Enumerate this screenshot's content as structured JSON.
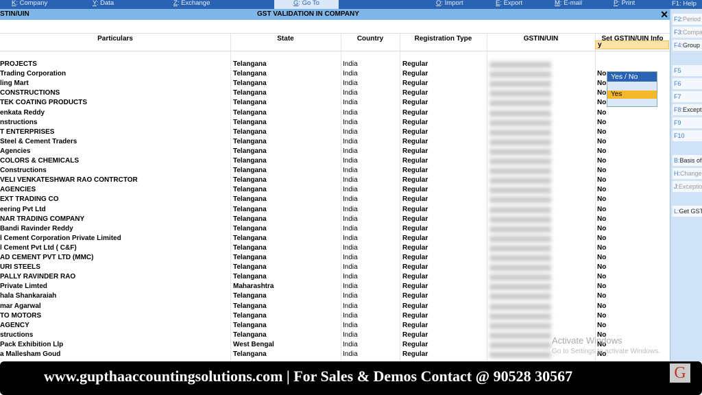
{
  "topbar": {
    "items": [
      {
        "key": "K",
        "label": "Company"
      },
      {
        "key": "Y",
        "label": "Data"
      },
      {
        "key": "Z",
        "label": "Exchange"
      },
      {
        "key": "G",
        "label": "Go To"
      },
      {
        "key": "O",
        "label": "Import"
      },
      {
        "key": "E",
        "label": "Export"
      },
      {
        "key": "M",
        "label": "E-mail"
      },
      {
        "key": "P",
        "label": "Print"
      }
    ],
    "help": "F1: Help"
  },
  "titlebar": {
    "left": "STIN/UIN",
    "center": "GST VALIDATION IN COMPANY",
    "close": "✕"
  },
  "columns": [
    "Particulars",
    "State",
    "Country",
    "Registration Type",
    "GSTIN/UIN",
    "Set GSTIN/UIN Info"
  ],
  "rows": [
    [
      "PROJECTS",
      "Telangana",
      "India",
      "Regular",
      "y"
    ],
    [
      "Trading Corporation",
      "Telangana",
      "India",
      "Regular",
      "No"
    ],
    [
      "ling Mart",
      "Telangana",
      "India",
      "Regular",
      "No"
    ],
    [
      "CONSTRUCTIONS",
      "Telangana",
      "India",
      "Regular",
      "No"
    ],
    [
      "TEK COATING PRODUCTS",
      "Telangana",
      "India",
      "Regular",
      "No"
    ],
    [
      "enkata Reddy",
      "Telangana",
      "India",
      "Regular",
      "No"
    ],
    [
      "nstructions",
      "Telangana",
      "India",
      "Regular",
      "No"
    ],
    [
      "T ENTERPRISES",
      "Telangana",
      "India",
      "Regular",
      "No"
    ],
    [
      "Steel & Cement Traders",
      "Telangana",
      "India",
      "Regular",
      "No"
    ],
    [
      "Agencies",
      "Telangana",
      "India",
      "Regular",
      "No"
    ],
    [
      "COLORS & CHEMICALS",
      "Telangana",
      "India",
      "Regular",
      "No"
    ],
    [
      "Constructions",
      "Telangana",
      "India",
      "Regular",
      "No"
    ],
    [
      "VELI VENKATESHWAR RAO CONTRCTOR",
      "Telangana",
      "India",
      "Regular",
      "No"
    ],
    [
      "AGENCIES",
      "Telangana",
      "India",
      "Regular",
      "No"
    ],
    [
      "EXT TRADING CO",
      "Telangana",
      "India",
      "Regular",
      "No"
    ],
    [
      "eering Pvt Ltd",
      "Telangana",
      "India",
      "Regular",
      "No"
    ],
    [
      "NAR TRADING COMPANY",
      "Telangana",
      "India",
      "Regular",
      "No"
    ],
    [
      "Bandi Ravinder Reddy",
      "Telangana",
      "India",
      "Regular",
      "No"
    ],
    [
      "l Cement Corporation Private Limited",
      "Telangana",
      "India",
      "Regular",
      "No"
    ],
    [
      "l Cement Pvt Ltd ( C&F)",
      "Telangana",
      "India",
      "Regular",
      "No"
    ],
    [
      "AD CEMENT PVT LTD (MMC)",
      "Telangana",
      "India",
      "Regular",
      "No"
    ],
    [
      "URI STEELS",
      "Telangana",
      "India",
      "Regular",
      "No"
    ],
    [
      "PALLY RAVINDER RAO",
      "Telangana",
      "India",
      "Regular",
      "No"
    ],
    [
      "Private Limted",
      "Maharashtra",
      "India",
      "Regular",
      "No"
    ],
    [
      "hala Shankaraiah",
      "Telangana",
      "India",
      "Regular",
      "No"
    ],
    [
      "mar Agarwal",
      "Telangana",
      "India",
      "Regular",
      "No"
    ],
    [
      "TO MOTORS",
      "Telangana",
      "India",
      "Regular",
      "No"
    ],
    [
      "AGENCY",
      "Telangana",
      "India",
      "Regular",
      "No"
    ],
    [
      "structions",
      "Telangana",
      "India",
      "Regular",
      "No"
    ],
    [
      "Pack Exhibition Llp",
      "West Bengal",
      "India",
      "Regular",
      "No"
    ],
    [
      "a Mallesham Goud",
      "Telangana",
      "India",
      "Regular",
      "No"
    ]
  ],
  "dropdown": {
    "title": "Yes / No",
    "options": [
      "",
      "Yes",
      ""
    ],
    "selected": "Yes"
  },
  "rightpanel": [
    {
      "k": "F2:",
      "l": "Period",
      "on": false
    },
    {
      "k": "F3:",
      "l": "Company",
      "on": false
    },
    {
      "k": "F4:",
      "l": "Group",
      "on": true
    },
    {
      "k": "F5",
      "l": "",
      "on": false
    },
    {
      "k": "F6",
      "l": "",
      "on": false
    },
    {
      "k": "F7",
      "l": "",
      "on": false
    },
    {
      "k": "F8:",
      "l": "Exceptions",
      "on": true
    },
    {
      "k": "F9",
      "l": "",
      "on": false
    },
    {
      "k": "F10",
      "l": "",
      "on": false
    },
    {
      "k": "B:",
      "l": "Basis of",
      "on": true
    },
    {
      "k": "H:",
      "l": "Change",
      "on": false
    },
    {
      "k": "J:",
      "l": "Exception",
      "on": false
    },
    {
      "k": "L:",
      "l": "Get GSTIN",
      "on": true
    }
  ],
  "watermark": {
    "title": "Activate Windows",
    "sub": "Go to Settings to activate Windows."
  },
  "banner": {
    "text": "www.gupthaaccountingsolutions.com | For Sales & Demos Contact @ 90528 30567",
    "logo": "G"
  },
  "colors": {
    "menu": "#2a63b3",
    "title": "#7fb6e8",
    "highlight": "#f5b82a"
  }
}
